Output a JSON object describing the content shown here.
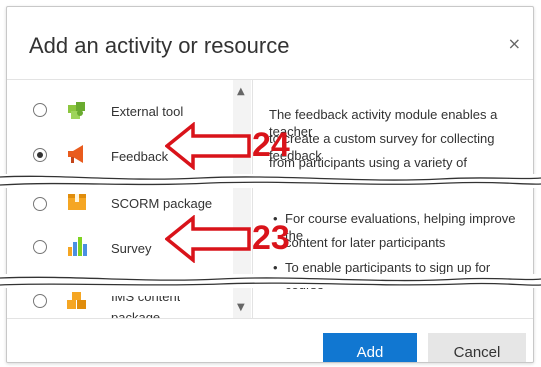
{
  "dialog": {
    "title": "Add an activity or resource",
    "close_glyph": "×"
  },
  "items": [
    {
      "label": "External tool",
      "selected": false,
      "icon": "puzzle-icon"
    },
    {
      "label": "Feedback",
      "selected": true,
      "icon": "megaphone-icon"
    },
    {
      "label": "SCORM package",
      "selected": false,
      "icon": "scorm-box-icon"
    },
    {
      "label": "Survey",
      "selected": false,
      "icon": "bar-chart-icon"
    },
    {
      "label_line1": "IMS content",
      "label_line2": "package",
      "selected": false,
      "icon": "ims-package-icon"
    }
  ],
  "description": {
    "line1": "The feedback activity module enables a teacher",
    "line2": "to create a custom survey for collecting feedback",
    "line3": "from participants using a variety of question",
    "bullet1_a": "For course evaluations, helping improve the",
    "bullet1_b": "content for later participants",
    "bullet2": "To enable participants to sign up for course"
  },
  "buttons": {
    "add": "Add",
    "cancel": "Cancel"
  },
  "callouts": {
    "first": "24",
    "second": "23"
  },
  "colors": {
    "accent": "#1177d1",
    "callout": "#d9131a"
  }
}
